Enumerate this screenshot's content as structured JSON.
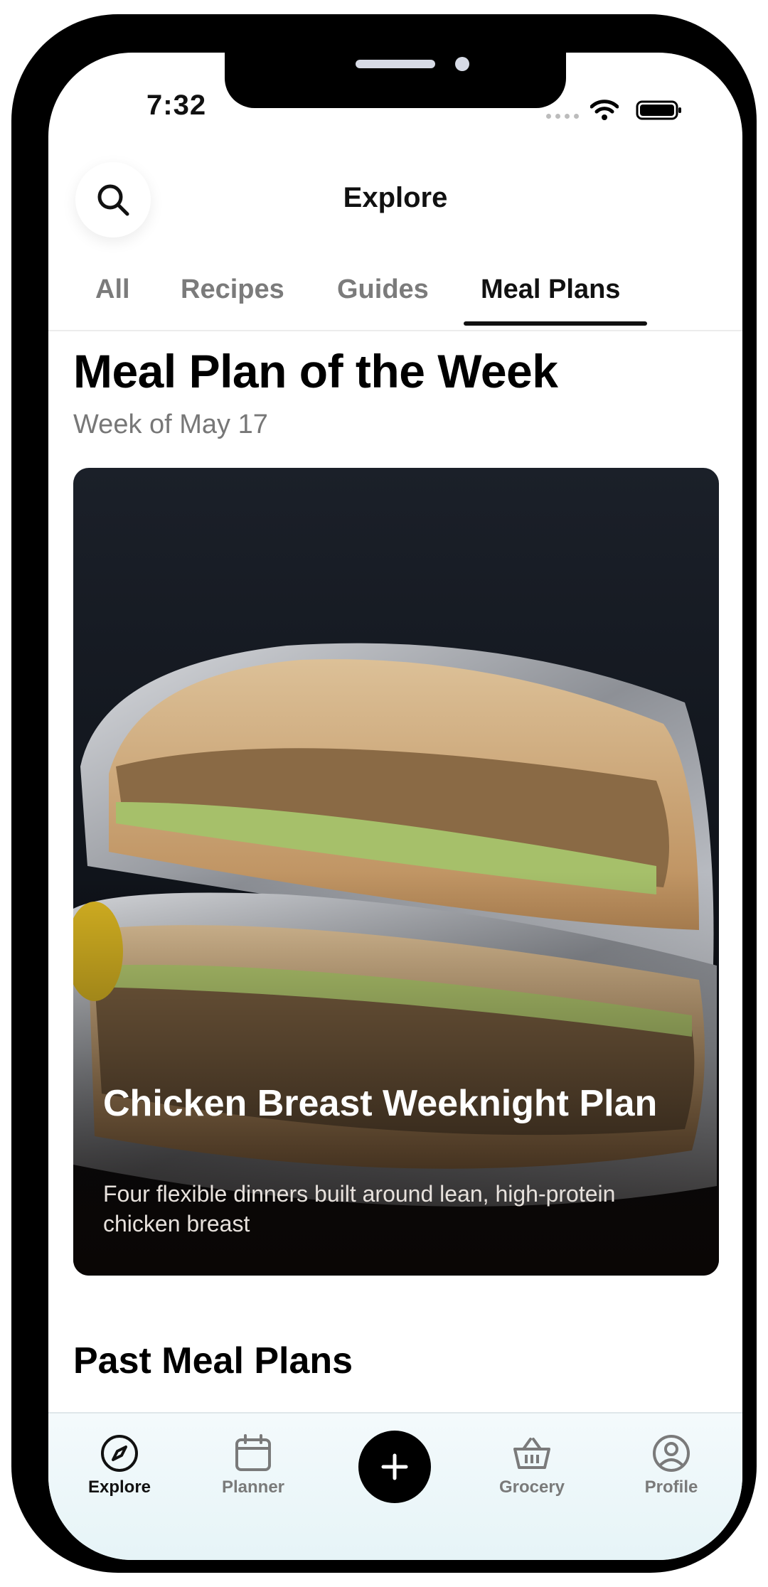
{
  "status_bar": {
    "time": "7:32"
  },
  "header": {
    "title": "Explore"
  },
  "tabs": [
    {
      "label": "All",
      "active": false
    },
    {
      "label": "Recipes",
      "active": false
    },
    {
      "label": "Guides",
      "active": false
    },
    {
      "label": "Meal Plans",
      "active": true
    }
  ],
  "featured": {
    "heading": "Meal Plan of the Week",
    "subheading": "Week of May 17",
    "card": {
      "title": "Chicken Breast Weeknight Plan",
      "description": "Four flexible dinners built around lean, high-protein chicken breast"
    }
  },
  "past": {
    "heading": "Past Meal Plans"
  },
  "bottom_nav": {
    "items": [
      {
        "label": "Explore",
        "icon": "compass-icon",
        "active": true
      },
      {
        "label": "Planner",
        "icon": "calendar-icon",
        "active": false
      },
      {
        "label": "Grocery",
        "icon": "basket-icon",
        "active": false
      },
      {
        "label": "Profile",
        "icon": "user-circle-icon",
        "active": false
      }
    ],
    "add_icon": "plus-icon"
  },
  "colors": {
    "accent": "#000000",
    "tab_inactive": "#7b7b7b",
    "tabbar_bg": "#e9f5f8"
  }
}
